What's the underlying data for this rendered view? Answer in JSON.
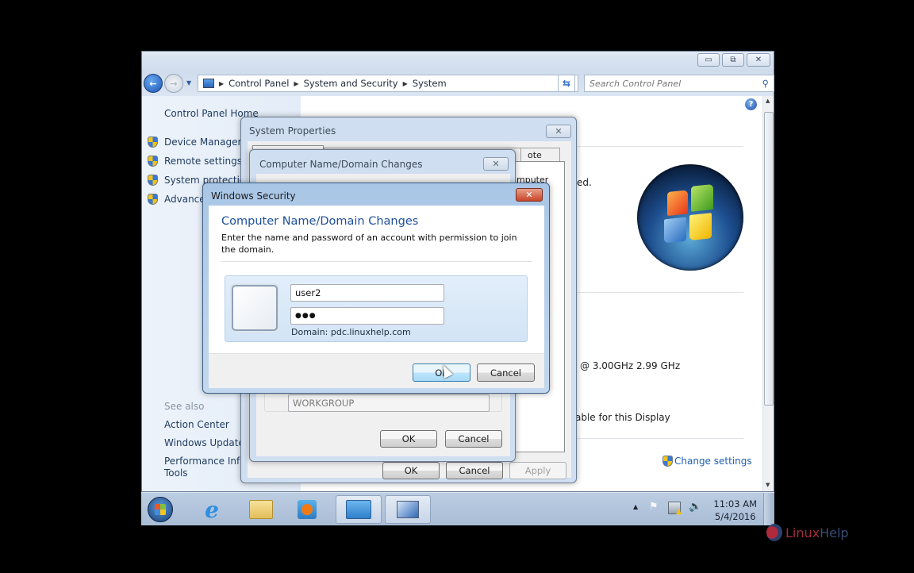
{
  "explorer": {
    "window_controls": {
      "minimize": "▭",
      "maximize": "⧉",
      "close": "✕"
    },
    "breadcrumb": [
      "Control Panel",
      "System and Security",
      "System"
    ],
    "search_placeholder": "Search Control Panel",
    "left_pane": {
      "home_link": "Control Panel Home",
      "tasks": [
        "Device Manager",
        "Remote settings",
        "System protection",
        "Advanced system settings"
      ],
      "see_also_heading": "See also",
      "see_also": [
        "Action Center",
        "Windows Update",
        "Performance Information and Tools"
      ],
      "see_also_display": [
        "Action Center",
        "Windows Update",
        "Performance Infor",
        "Tools"
      ]
    },
    "content": {
      "partial_texts": {
        "activated_fragment": "ed.",
        "computer_fragment": "mputer",
        "cpu_fragment": "@ 3.00GHz   2.99 GHz",
        "display_fragment": "able for this Display"
      },
      "change_settings": "Change settings",
      "help_icon": "?"
    }
  },
  "taskbar": {
    "items": [
      "start-orb",
      "internet-explorer",
      "windows-explorer",
      "media-player",
      "control-panel",
      "system"
    ],
    "time": "11:03 AM",
    "date": "5/4/2016"
  },
  "system_properties": {
    "title": "System Properties",
    "tab_fragment": "ote",
    "buttons": {
      "ok": "OK",
      "cancel": "Cancel",
      "apply": "Apply"
    }
  },
  "domain_changes": {
    "title": "Computer Name/Domain Changes",
    "workgroup_value": "WORKGROUP",
    "buttons": {
      "ok": "OK",
      "cancel": "Cancel"
    }
  },
  "windows_security": {
    "title": "Windows Security",
    "heading": "Computer Name/Domain Changes",
    "description": "Enter the name and password of an account with permission to join the domain.",
    "username": "user2",
    "password_masked": "●●●",
    "domain_label": "Domain: pdc.linuxhelp.com",
    "buttons": {
      "ok": "OK",
      "cancel": "Cancel"
    }
  },
  "watermark": {
    "part1": "Linux",
    "part2": "Help"
  }
}
